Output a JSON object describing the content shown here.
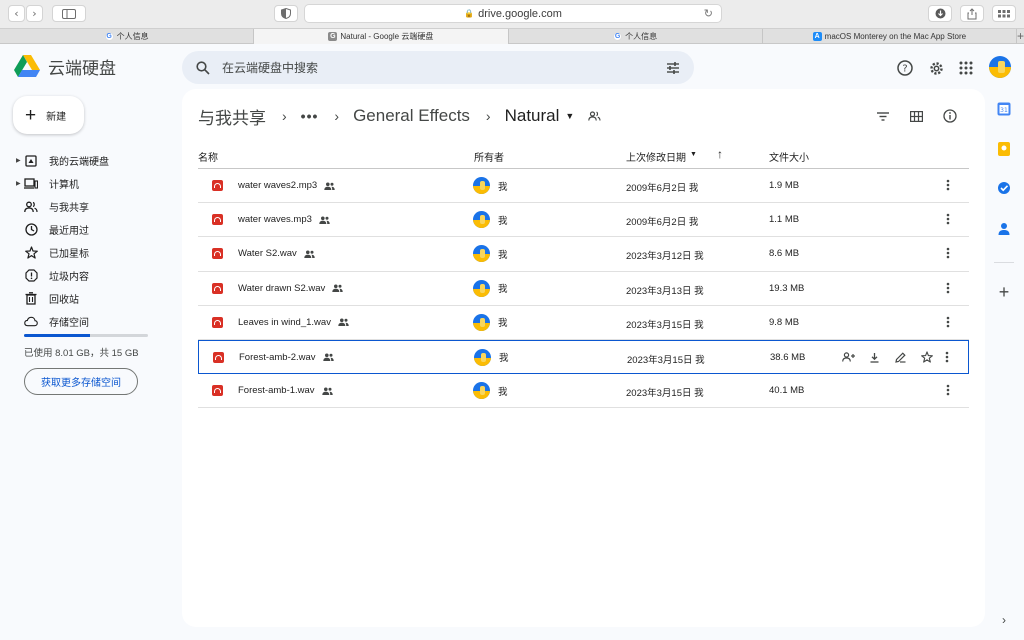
{
  "browser": {
    "url": "drive.google.com",
    "tabs": [
      {
        "title": "个人信息",
        "active": false,
        "favicon": "google-g"
      },
      {
        "title": "Natural - Google 云端硬盘",
        "active": true,
        "favicon": "drive-grey"
      },
      {
        "title": "个人信息",
        "active": false,
        "favicon": "google-g"
      },
      {
        "title": "macOS Monterey on the Mac App Store",
        "active": false,
        "favicon": "app-store"
      }
    ]
  },
  "app": {
    "name": "云端硬盘",
    "search_placeholder": "在云端硬盘中搜索"
  },
  "sidebar": {
    "new_label": "新建",
    "items": [
      {
        "label": "我的云端硬盘",
        "icon": "my-drive-icon",
        "expandable": true
      },
      {
        "label": "计算机",
        "icon": "computer-icon",
        "expandable": true
      },
      {
        "label": "与我共享",
        "icon": "people-icon",
        "expandable": false
      },
      {
        "label": "最近用过",
        "icon": "clock-icon",
        "expandable": false
      },
      {
        "label": "已加星标",
        "icon": "star-icon",
        "expandable": false
      },
      {
        "label": "垃圾内容",
        "icon": "spam-icon",
        "expandable": false
      },
      {
        "label": "回收站",
        "icon": "trash-icon",
        "expandable": false
      },
      {
        "label": "存储空间",
        "icon": "cloud-icon",
        "expandable": false
      }
    ],
    "storage_used_fraction": 0.534,
    "storage_text": "已使用 8.01 GB，共 15 GB",
    "get_storage_label": "获取更多存储空间"
  },
  "breadcrumb": {
    "root": "与我共享",
    "ellipsis": "•••",
    "parent": "General Effects",
    "current": "Natural"
  },
  "table": {
    "columns": {
      "name": "名称",
      "owner": "所有者",
      "modified": "上次修改日期",
      "size": "文件大小"
    },
    "rows": [
      {
        "name": "water waves2.mp3",
        "owner": "我",
        "modified": "2009年6月2日 我",
        "size": "1.9 MB",
        "selected": false
      },
      {
        "name": "water waves.mp3",
        "owner": "我",
        "modified": "2009年6月2日 我",
        "size": "1.1 MB",
        "selected": false
      },
      {
        "name": "Water S2.wav",
        "owner": "我",
        "modified": "2023年3月12日 我",
        "size": "8.6 MB",
        "selected": false
      },
      {
        "name": "Water drawn S2.wav",
        "owner": "我",
        "modified": "2023年3月13日 我",
        "size": "19.3 MB",
        "selected": false
      },
      {
        "name": "Leaves in wind_1.wav",
        "owner": "我",
        "modified": "2023年3月15日 我",
        "size": "9.8 MB",
        "selected": false
      },
      {
        "name": "Forest-amb-2.wav",
        "owner": "我",
        "modified": "2023年3月15日 我",
        "size": "38.6 MB",
        "selected": true
      },
      {
        "name": "Forest-amb-1.wav",
        "owner": "我",
        "modified": "2023年3月15日 我",
        "size": "40.1 MB",
        "selected": false
      }
    ]
  },
  "colors": {
    "accent": "#0b57d0",
    "audio_file": "#d93025",
    "search_bg": "#e9eef6",
    "page_bg": "#f8fafd"
  }
}
